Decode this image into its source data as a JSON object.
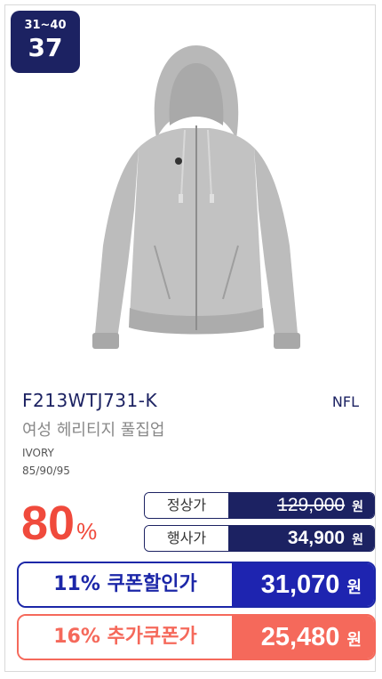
{
  "rank": {
    "range": "31~40",
    "number": "37"
  },
  "product": {
    "code": "F213WTJ731-K",
    "brand": "NFL",
    "name": "여성 헤리티지 풀집업",
    "color": "IVORY",
    "sizes": "85/90/95",
    "image": "gray-zip-hoodie"
  },
  "discount": {
    "value": "80",
    "unit": "%"
  },
  "prices": {
    "regular": {
      "label": "정상가",
      "amount": "129,000",
      "unit": "원"
    },
    "event": {
      "label": "행사가",
      "amount": "34,900",
      "unit": "원"
    },
    "coupon": {
      "percent": "11%",
      "label": "쿠폰할인가",
      "amount": "31,070",
      "unit": "원"
    },
    "extra": {
      "percent": "16%",
      "label": "추가쿠폰가",
      "amount": "25,480",
      "unit": "원"
    }
  },
  "colors": {
    "navy": "#1c2262",
    "coupon_blue": "#1e24b0",
    "accent_red": "#f04a3c",
    "coral": "#f5695b"
  }
}
